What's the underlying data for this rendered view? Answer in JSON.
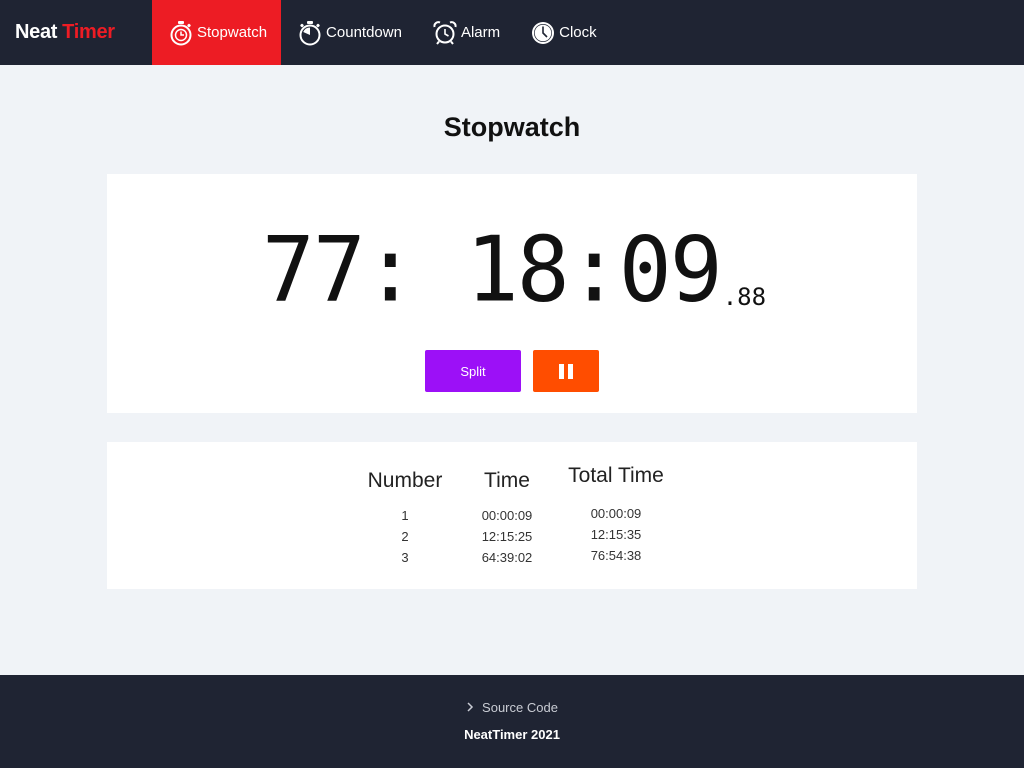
{
  "brand": {
    "part1": "Neat",
    "part2": "Timer",
    "accent_color": "#ed1c24"
  },
  "nav": {
    "items": [
      {
        "label": "Stopwatch",
        "icon": "stopwatch-icon",
        "active": true
      },
      {
        "label": "Countdown",
        "icon": "timer-icon",
        "active": false
      },
      {
        "label": "Alarm",
        "icon": "alarm-clock-icon",
        "active": false
      },
      {
        "label": "Clock",
        "icon": "clock-icon",
        "active": false
      }
    ]
  },
  "page": {
    "title": "Stopwatch"
  },
  "timer": {
    "display": "77: 18:09",
    "fraction": ".88",
    "split_label": "Split",
    "split_color": "#9c10f7",
    "pause_color": "#ff4d00",
    "pause_icon": "pause-icon"
  },
  "laps": {
    "headers": {
      "number": "Number",
      "time": "Time",
      "total": "Total Time"
    },
    "rows": [
      {
        "number": "1",
        "time": "00:00:09",
        "total": "00:00:09"
      },
      {
        "number": "2",
        "time": "12:15:25",
        "total": "12:15:35"
      },
      {
        "number": "3",
        "time": "64:39:02",
        "total": "76:54:38"
      }
    ]
  },
  "footer": {
    "source_label": "Source Code",
    "source_icon": "chevron-right-icon",
    "copyright": "NeatTimer 2021",
    "background": "#1f2433"
  }
}
